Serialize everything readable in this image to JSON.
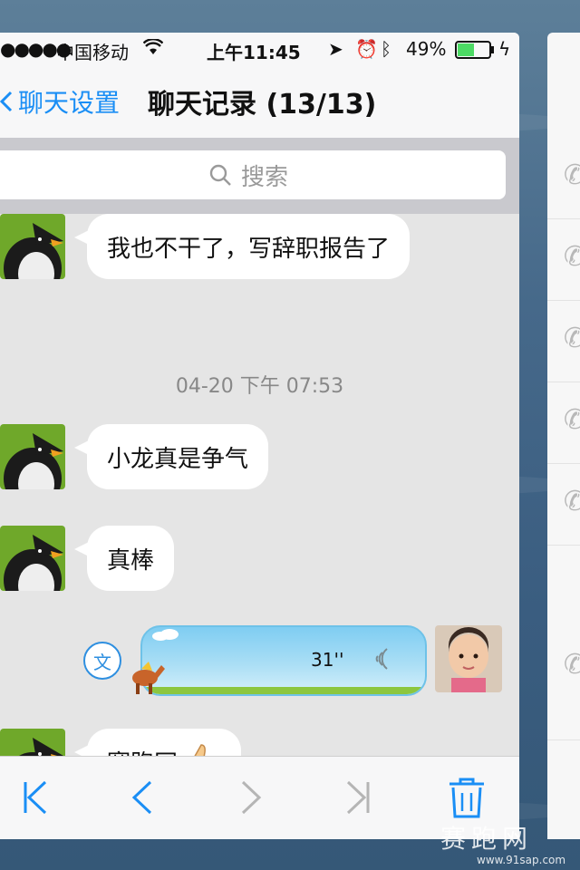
{
  "status_bar": {
    "carrier": "中国移动",
    "time": "上午11:45",
    "battery": "49%"
  },
  "nav": {
    "back_label": "聊天设置",
    "title": "聊天记录 (13/13)"
  },
  "search": {
    "placeholder": "搜索"
  },
  "messages": [
    {
      "text": "我也不干了，写辞职报告了"
    },
    {
      "timestamp": "04-20 下午 07:53"
    },
    {
      "text": "小龙真是争气"
    },
    {
      "text": "真棒"
    },
    {
      "voice_duration": "31''",
      "translate_label": "文"
    },
    {
      "text": "赛跑网",
      "emoji": "thumbs-up"
    }
  ],
  "watermark": {
    "title": "赛跑网",
    "url": "www.91sap.com"
  },
  "colors": {
    "accent": "#1a8ef5",
    "bubble": "#ffffff",
    "chat_bg": "#e5e5e5",
    "voice_bubble": "#aadef5"
  }
}
